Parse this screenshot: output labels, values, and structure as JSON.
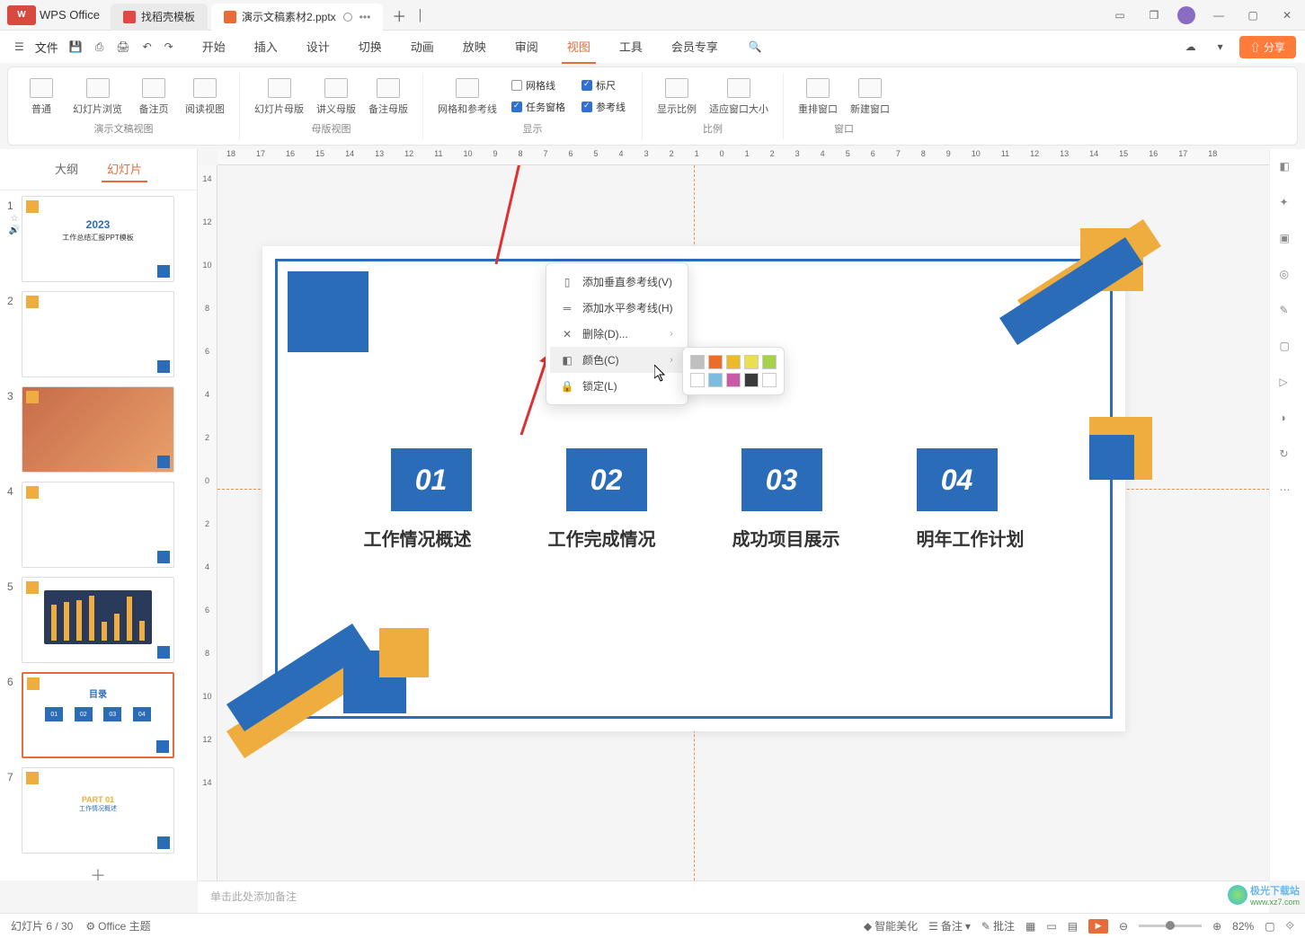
{
  "titlebar": {
    "app_name": "WPS Office",
    "tab1": "找稻壳模板",
    "tab2": "演示文稿素材2.pptx"
  },
  "menubar": {
    "file": "文件",
    "tabs": [
      "开始",
      "插入",
      "设计",
      "切换",
      "动画",
      "放映",
      "审阅",
      "视图",
      "工具",
      "会员专享"
    ],
    "active_index": 7,
    "share": "分享"
  },
  "ribbon": {
    "group1": {
      "label": "演示文稿视图",
      "items": [
        "普通",
        "幻灯片浏览",
        "备注页",
        "阅读视图"
      ]
    },
    "group2": {
      "label": "母版视图",
      "items": [
        "幻灯片母版",
        "讲义母版",
        "备注母版"
      ]
    },
    "group3": {
      "label": "显示",
      "item1": "网格和参考线",
      "checks": [
        {
          "label": "网格线",
          "checked": false
        },
        {
          "label": "任务窗格",
          "checked": true
        },
        {
          "label": "标尺",
          "checked": true
        },
        {
          "label": "参考线",
          "checked": true
        }
      ]
    },
    "group4": {
      "label": "比例",
      "items": [
        "显示比例",
        "适应窗口大小"
      ]
    },
    "group5": {
      "label": "窗口",
      "items": [
        "重排窗口",
        "新建窗口"
      ]
    }
  },
  "left_panel": {
    "tab_outline": "大纲",
    "tab_slides": "幻灯片",
    "selected": 6,
    "total": 7
  },
  "slide": {
    "title": "目录",
    "nums": [
      "01",
      "02",
      "03",
      "04"
    ],
    "labels": [
      "工作情况概述",
      "工作完成情况",
      "成功项目展示",
      "明年工作计划"
    ]
  },
  "context_menu": {
    "items": [
      {
        "label": "添加垂直参考线(V)",
        "name": "add-vertical-guide"
      },
      {
        "label": "添加水平参考线(H)",
        "name": "add-horizontal-guide"
      },
      {
        "label": "删除(D)...",
        "name": "delete-guide",
        "arrow": true
      },
      {
        "label": "颜色(C)",
        "name": "guide-color",
        "arrow": true,
        "hover": true
      },
      {
        "label": "锁定(L)",
        "name": "lock-guide"
      }
    ],
    "colors": [
      "#bfbfbf",
      "#ec6c2a",
      "#ecbb2a",
      "#eadf50",
      "#a4d349",
      "#7bbce0",
      "#c85aa6",
      "#5a5a5a",
      "#ffffff",
      "#000000"
    ]
  },
  "notes": {
    "placeholder": "单击此处添加备注"
  },
  "statusbar": {
    "slide_pos": "幻灯片 6 / 30",
    "theme": "Office 主题",
    "ai": "智能美化",
    "notes": "备注",
    "comments": "批注",
    "zoom": "82%"
  },
  "hruler": [
    "18",
    "17",
    "16",
    "15",
    "14",
    "13",
    "12",
    "11",
    "10",
    "9",
    "8",
    "7",
    "6",
    "5",
    "4",
    "3",
    "2",
    "1",
    "0",
    "1",
    "2",
    "3",
    "4",
    "5",
    "6",
    "7",
    "8",
    "9",
    "10",
    "11",
    "12",
    "13",
    "14",
    "15",
    "16",
    "17",
    "18"
  ],
  "vruler": [
    "14",
    "12",
    "10",
    "8",
    "6",
    "4",
    "2",
    "0",
    "2",
    "4",
    "6",
    "8",
    "10",
    "12",
    "14"
  ],
  "thumbs": [
    {
      "title": "2023",
      "subtitle": "工作总结汇报PPT模板"
    },
    {
      "title": ""
    },
    {
      "title": ""
    },
    {
      "title": ""
    },
    {
      "title": ""
    },
    {
      "title": "目录"
    },
    {
      "title": "PART 01",
      "sub": "工作情况概述"
    }
  ]
}
